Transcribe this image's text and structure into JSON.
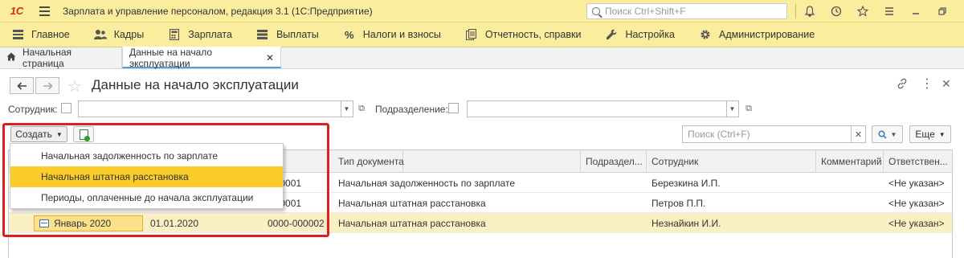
{
  "titlebar": {
    "logo": "1С",
    "title": "Зарплата и управление персоналом, редакция 3.1  (1С:Предприятие)",
    "search_placeholder": "Поиск Ctrl+Shift+F",
    "icons": [
      "bell-icon",
      "history-icon",
      "star-icon",
      "menu-icon",
      "minimize-icon",
      "restore-icon",
      "close-icon"
    ]
  },
  "mainmenu": {
    "items": [
      {
        "label": "Главное",
        "icon": "bars-icon"
      },
      {
        "label": "Кадры",
        "icon": "people-icon"
      },
      {
        "label": "Зарплата",
        "icon": "calculator-icon"
      },
      {
        "label": "Выплаты",
        "icon": "list-icon"
      },
      {
        "label": "Налоги и взносы",
        "icon": "percent-icon"
      },
      {
        "label": "Отчетность, справки",
        "icon": "reports-icon"
      },
      {
        "label": "Настройка",
        "icon": "wrench-icon"
      },
      {
        "label": "Администрирование",
        "icon": "gear-icon"
      }
    ]
  },
  "tabs": {
    "home": "Начальная страница",
    "active": "Данные на начало эксплуатации"
  },
  "form": {
    "title": "Данные на начало эксплуатации",
    "filters": {
      "employee_label": "Сотрудник:",
      "department_label": "Подразделение:"
    },
    "toolbar": {
      "create_label": "Создать",
      "search_placeholder": "Поиск (Ctrl+F)",
      "more_label": "Еще"
    },
    "dropdown": [
      "Начальная задолженность по зарплате",
      "Начальная штатная расстановка",
      "Периоды, оплаченные до начала эксплуатации"
    ],
    "table": {
      "headers": [
        "ер",
        "Тип документа",
        "Подраздел...",
        "Сотрудник",
        "Комментарий",
        "Ответствен..."
      ],
      "rows": [
        {
          "period": "",
          "date": "",
          "number": "-000001",
          "type": "Начальная задолженность по зарплате",
          "department": "",
          "employee": "Березкина И.П.",
          "comment": "",
          "responsible": "<Не указан>"
        },
        {
          "period": "",
          "date": "",
          "number": "-000001",
          "type": "Начальная штатная расстановка",
          "department": "",
          "employee": "Петров П.П.",
          "comment": "",
          "responsible": "<Не указан>"
        },
        {
          "period": "Январь 2020",
          "date": "01.01.2020",
          "number": "0000-000002",
          "type": "Начальная штатная расстановка",
          "department": "",
          "employee": "Незнайкин И.И.",
          "comment": "",
          "responsible": "<Не указан>"
        }
      ]
    }
  },
  "colors": {
    "titlebar_bg": "#fbed9e",
    "highlight": "#fbcd2a",
    "selected_row": "#fbf0c4",
    "red_frame": "#e02020"
  }
}
